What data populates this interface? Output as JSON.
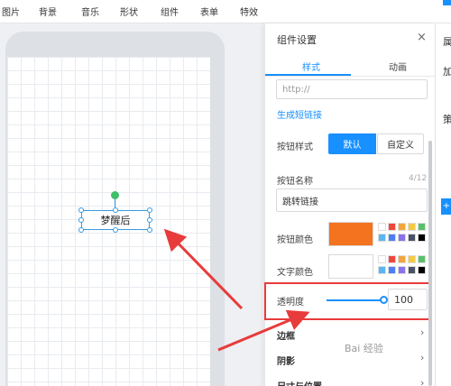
{
  "toolbar": {
    "items": [
      "图片",
      "背景",
      "音乐",
      "形状",
      "组件",
      "表单",
      "特效"
    ]
  },
  "canvas": {
    "component_label": "梦醒后"
  },
  "panel": {
    "title": "组件设置",
    "close": "×",
    "tabs": [
      "样式",
      "动画"
    ],
    "url_placeholder": "http://",
    "short_link_label": "生成短链接",
    "button_style_label": "按钮样式",
    "style_default": "默认",
    "style_custom": "自定义",
    "button_name_label": "按钮名称",
    "name_counter": "4/12",
    "button_name_value": "跳转链接",
    "button_color_label": "按钮颜色",
    "text_color_label": "文字颜色",
    "opacity_label": "透明度",
    "opacity_value": "100",
    "sections": [
      "边框",
      "阴影",
      "尺寸与位置"
    ]
  },
  "right_edge": [
    "属",
    "加",
    "策"
  ],
  "colors": {
    "accent": "#1890ff",
    "button_color": "#f4731f",
    "text_color": "#ffffff",
    "highlight_red": "#e83b3b",
    "palette": [
      "#ffffff",
      "#f0473c",
      "#f4a63b",
      "#f6c945",
      "#5bbf6a",
      "#5ab6f2",
      "#4d7ff2",
      "#8a73e8",
      "#4a5365",
      "#000000"
    ]
  },
  "watermark": "Bai 经验"
}
